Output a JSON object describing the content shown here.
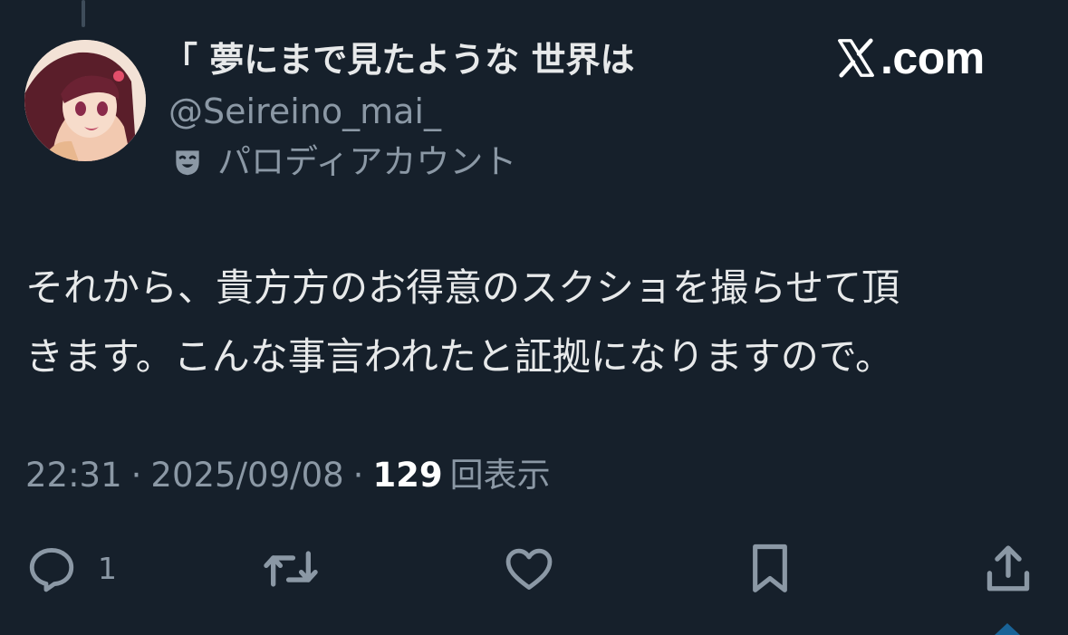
{
  "author": {
    "display_name": "「 夢にまで見たような 世界は",
    "handle": "@Seireino_mai_",
    "label": "パロディアカウント",
    "label_icon": "theater-mask-icon",
    "avatar_icon": "anime-avatar"
  },
  "brand": {
    "text": ".com",
    "logo_icon": "x-logo-icon"
  },
  "tweet": {
    "lines": [
      "それから、貴方方のお得意のスクショを撮らせて頂",
      "きます。こんな事言われたと証拠になりますので。"
    ]
  },
  "meta": {
    "time": "22:31",
    "separator": "·",
    "date": "2025/09/08",
    "views_count": "129",
    "views_label": "回表示"
  },
  "actions": {
    "reply_icon": "reply-icon",
    "reply_count": "1",
    "retweet_icon": "retweet-icon",
    "like_icon": "heart-icon",
    "bookmark_icon": "bookmark-icon",
    "share_icon": "share-icon"
  },
  "colors": {
    "background": "#16202b",
    "text_primary": "#e7e9ea",
    "text_secondary": "#8b98a5",
    "icon": "#8b98a5"
  }
}
